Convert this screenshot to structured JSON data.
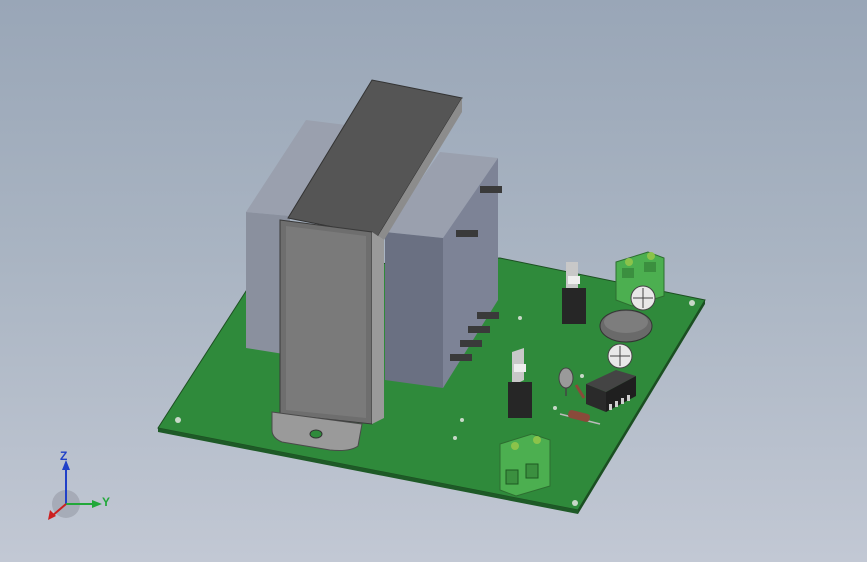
{
  "viewport": {
    "background_top": "#99a6b7",
    "background_bottom": "#c2c8d4"
  },
  "triad": {
    "x_label": "",
    "y_label": "Y",
    "z_label": "Z",
    "x_color": "#cc2020",
    "y_color": "#22a83a",
    "z_color": "#2040c8"
  },
  "colors": {
    "pcb": "#2f8a3b",
    "transformer_core": "#5a5a5a",
    "coil": "#7d8396",
    "terminal_block": "#4caf50",
    "ic_body": "#2a2a2a",
    "capacitor": "#6a6a6a"
  }
}
